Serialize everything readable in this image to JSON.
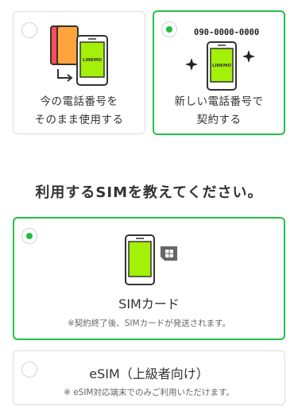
{
  "top_options": {
    "keep_number": {
      "line1": "今の電話番号を",
      "line2": "そのまま使用する",
      "selected": false
    },
    "new_number": {
      "phone_number": "090-0000-0000",
      "line1": "新しい電話番号で",
      "line2": "契約する",
      "selected": true
    }
  },
  "phone_screen_label": "LINEMO",
  "sim_section": {
    "title": "利用するSIMを教えてください。",
    "sim_card": {
      "label": "SIMカード",
      "note": "※契約終了後、SIMカードが発送されます。",
      "selected": true
    },
    "esim": {
      "label": "eSIM（上級者向け）",
      "note": "※ eSIM対応端末でのみご利用いただけます。",
      "selected": false
    }
  },
  "colors": {
    "accent_green": "#24c04a",
    "phone_screen_green": "#a3f008",
    "phone_red": "#ff4d57",
    "phone_orange": "#ffa43d",
    "border_gray": "#dcdcdc"
  }
}
